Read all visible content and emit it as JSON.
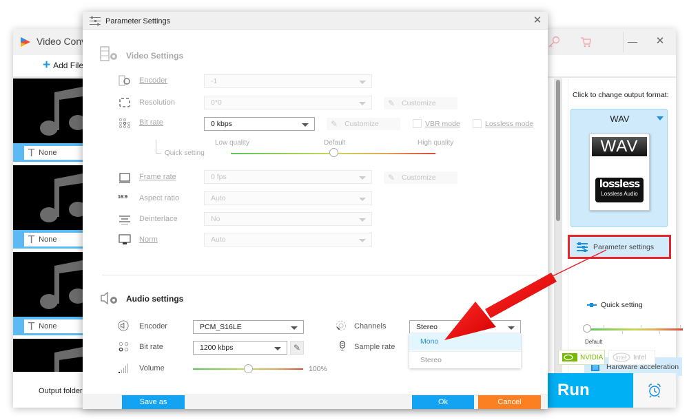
{
  "app": {
    "title": "Video Converter",
    "add_files_label": "Add Files",
    "file_items": [
      {
        "subtitle": "None"
      },
      {
        "subtitle": "None"
      },
      {
        "subtitle": "None"
      }
    ],
    "output_folder_label": "Output folder:",
    "right_panel": {
      "caption": "Click to change output format:",
      "format_name": "WAV",
      "format_icon_header": "WAV",
      "format_icon_badge": "lossless",
      "format_icon_sub": "Lossless Audio",
      "parameter_settings_label": "Parameter settings",
      "quick_setting_label": "Quick setting",
      "quick_setting_value": "Default",
      "hardware_acceleration_label": "Hardware acceleration",
      "nvidia_label": "NVIDIA",
      "intel_label": "Intel",
      "nvidia_enabled": true,
      "intel_enabled": false
    },
    "run_label": "Run"
  },
  "dialog": {
    "title": "Parameter Settings",
    "video": {
      "section_title": "Video Settings",
      "encoder": {
        "label": "Encoder",
        "value": "-1"
      },
      "resolution": {
        "label": "Resolution",
        "value": "0*0",
        "customize_label": "Customize"
      },
      "bitrate": {
        "label": "Bit rate",
        "value": "0 kbps",
        "customize_label": "Customize",
        "vbr_label": "VBR mode",
        "vbr_checked": false,
        "lossless_label": "Lossless mode",
        "lossless_checked": false
      },
      "quick_setting": {
        "label": "Quick setting",
        "low": "Low quality",
        "default": "Default",
        "high": "High quality",
        "position": 0.5
      },
      "frame_rate": {
        "label": "Frame rate",
        "value": "0 fps",
        "customize_label": "Customize"
      },
      "aspect_ratio": {
        "label": "Aspect ratio",
        "value": "Auto",
        "icon_text": "16:9"
      },
      "deinterlace": {
        "label": "Deinterlace",
        "value": "No"
      },
      "norm": {
        "label": "Norm",
        "value": "Auto"
      }
    },
    "audio": {
      "section_title": "Audio settings",
      "encoder": {
        "label": "Encoder",
        "value": "PCM_S16LE"
      },
      "bitrate": {
        "label": "Bit rate",
        "value": "1200 kbps"
      },
      "volume": {
        "label": "Volume",
        "value": "100%",
        "position": 0.5
      },
      "channels": {
        "label": "Channels",
        "value": "Stereo",
        "options": [
          "Mono",
          "Stereo"
        ],
        "highlighted": "Mono"
      },
      "sample_rate": {
        "label": "Sample rate"
      }
    },
    "footer": {
      "save_as_label": "Save as",
      "ok_label": "Ok",
      "cancel_label": "Cancel"
    }
  },
  "colors": {
    "accent_blue": "#14a3f3",
    "run_blue": "#00b0f4",
    "cancel_orange": "#fa8021",
    "highlight_red": "#e5262b",
    "panel_blue": "#d2ebfb"
  }
}
